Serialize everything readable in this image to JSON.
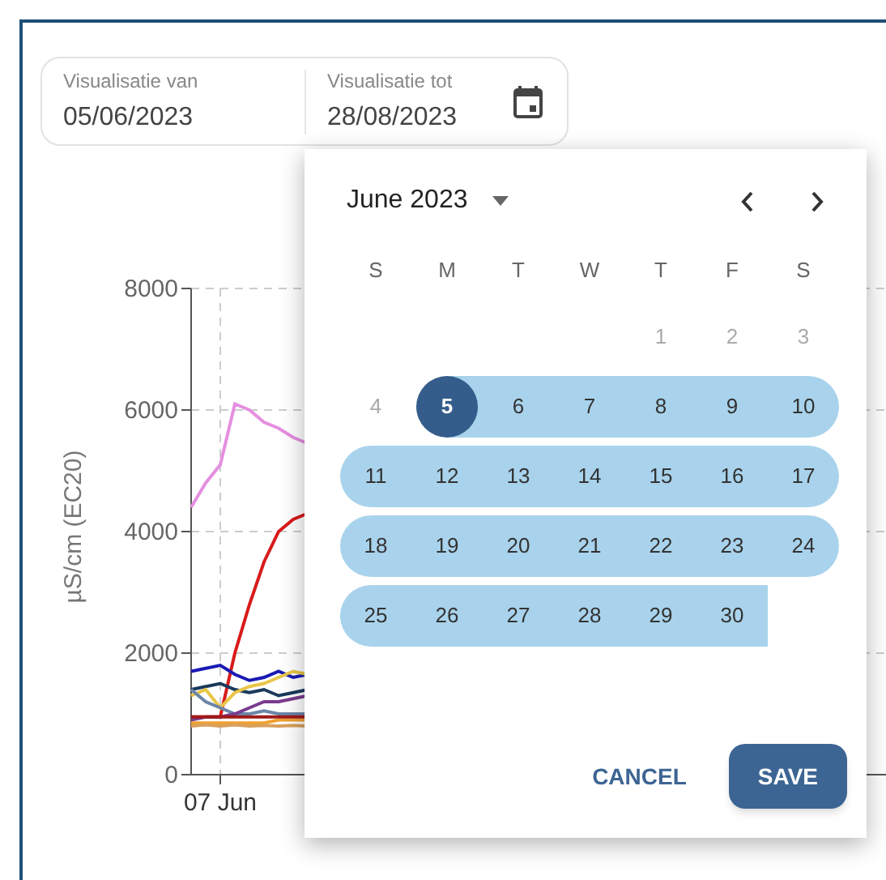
{
  "date_range": {
    "from": {
      "label": "Visualisatie van",
      "value": "05/06/2023"
    },
    "to": {
      "label": "Visualisatie tot",
      "value": "28/08/2023"
    }
  },
  "chart": {
    "y_axis_label": "µS/cm (EC20)",
    "y_ticks": [
      "8000",
      "6000",
      "4000",
      "2000",
      "0"
    ],
    "x_tick_label": "07 Jun"
  },
  "calendar": {
    "month": "June 2023",
    "weekdays": [
      "S",
      "M",
      "T",
      "W",
      "T",
      "F",
      "S"
    ],
    "weeks": [
      [
        {
          "kind": "blank"
        },
        {
          "kind": "blank"
        },
        {
          "kind": "blank"
        },
        {
          "kind": "blank"
        },
        {
          "kind": "day",
          "day": "1",
          "disabled": true,
          "selected": false,
          "in_range": false
        },
        {
          "kind": "day",
          "day": "2",
          "disabled": true,
          "selected": false,
          "in_range": false
        },
        {
          "kind": "day",
          "day": "3",
          "disabled": true,
          "selected": false,
          "in_range": false
        }
      ],
      [
        {
          "kind": "day",
          "day": "4",
          "disabled": true,
          "selected": false,
          "in_range": false
        },
        {
          "kind": "day",
          "day": "5",
          "disabled": false,
          "selected": true,
          "in_range": true
        },
        {
          "kind": "day",
          "day": "6",
          "disabled": false,
          "selected": false,
          "in_range": true
        },
        {
          "kind": "day",
          "day": "7",
          "disabled": false,
          "selected": false,
          "in_range": true
        },
        {
          "kind": "day",
          "day": "8",
          "disabled": false,
          "selected": false,
          "in_range": true
        },
        {
          "kind": "day",
          "day": "9",
          "disabled": false,
          "selected": false,
          "in_range": true
        },
        {
          "kind": "day",
          "day": "10",
          "disabled": false,
          "selected": false,
          "in_range": true
        }
      ],
      [
        {
          "kind": "day",
          "day": "11",
          "disabled": false,
          "selected": false,
          "in_range": true
        },
        {
          "kind": "day",
          "day": "12",
          "disabled": false,
          "selected": false,
          "in_range": true
        },
        {
          "kind": "day",
          "day": "13",
          "disabled": false,
          "selected": false,
          "in_range": true
        },
        {
          "kind": "day",
          "day": "14",
          "disabled": false,
          "selected": false,
          "in_range": true
        },
        {
          "kind": "day",
          "day": "15",
          "disabled": false,
          "selected": false,
          "in_range": true
        },
        {
          "kind": "day",
          "day": "16",
          "disabled": false,
          "selected": false,
          "in_range": true
        },
        {
          "kind": "day",
          "day": "17",
          "disabled": false,
          "selected": false,
          "in_range": true
        }
      ],
      [
        {
          "kind": "day",
          "day": "18",
          "disabled": false,
          "selected": false,
          "in_range": true
        },
        {
          "kind": "day",
          "day": "19",
          "disabled": false,
          "selected": false,
          "in_range": true
        },
        {
          "kind": "day",
          "day": "20",
          "disabled": false,
          "selected": false,
          "in_range": true
        },
        {
          "kind": "day",
          "day": "21",
          "disabled": false,
          "selected": false,
          "in_range": true
        },
        {
          "kind": "day",
          "day": "22",
          "disabled": false,
          "selected": false,
          "in_range": true
        },
        {
          "kind": "day",
          "day": "23",
          "disabled": false,
          "selected": false,
          "in_range": true
        },
        {
          "kind": "day",
          "day": "24",
          "disabled": false,
          "selected": false,
          "in_range": true
        }
      ],
      [
        {
          "kind": "day",
          "day": "25",
          "disabled": false,
          "selected": false,
          "in_range": true
        },
        {
          "kind": "day",
          "day": "26",
          "disabled": false,
          "selected": false,
          "in_range": true
        },
        {
          "kind": "day",
          "day": "27",
          "disabled": false,
          "selected": false,
          "in_range": true
        },
        {
          "kind": "day",
          "day": "28",
          "disabled": false,
          "selected": false,
          "in_range": true
        },
        {
          "kind": "day",
          "day": "29",
          "disabled": false,
          "selected": false,
          "in_range": true
        },
        {
          "kind": "day",
          "day": "30",
          "disabled": false,
          "selected": false,
          "in_range": true
        },
        {
          "kind": "blank"
        }
      ]
    ],
    "buttons": [
      {
        "label": "CANCEL",
        "kind": "text"
      },
      {
        "label": "SAVE",
        "kind": "filled"
      }
    ]
  }
}
